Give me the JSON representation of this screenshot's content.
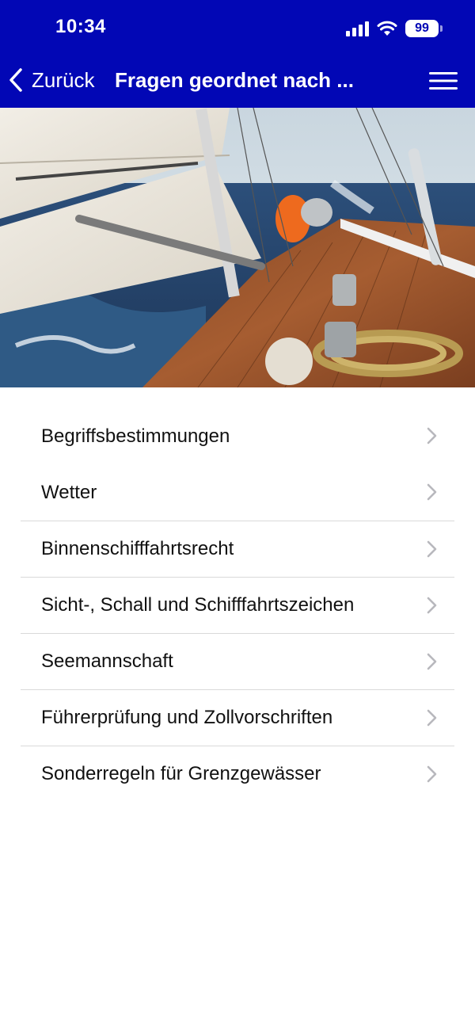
{
  "status_bar": {
    "time": "10:34",
    "battery": "99",
    "icons": [
      "signal-icon",
      "wifi-icon",
      "battery-icon"
    ]
  },
  "nav": {
    "back_label": "Zurück",
    "title": "Fragen geordnet nach ...",
    "back_icon": "chevron-left-icon",
    "menu_icon": "hamburger-menu-icon"
  },
  "colors": {
    "header_bg": "#0207b5",
    "chevron": "#b8b8bd",
    "separator": "#d9d9d9"
  },
  "categories": [
    {
      "label": "Begriffsbestimmungen"
    },
    {
      "label": "Wetter"
    },
    {
      "label": "Binnenschifffahrtsrecht"
    },
    {
      "label": "Sicht-, Schall und Schifffahrtszeichen"
    },
    {
      "label": "Seemannschaft"
    },
    {
      "label": "Führerprüfung und Zollvorschriften"
    },
    {
      "label": "Sonderregeln für Grenzgewässer"
    }
  ]
}
